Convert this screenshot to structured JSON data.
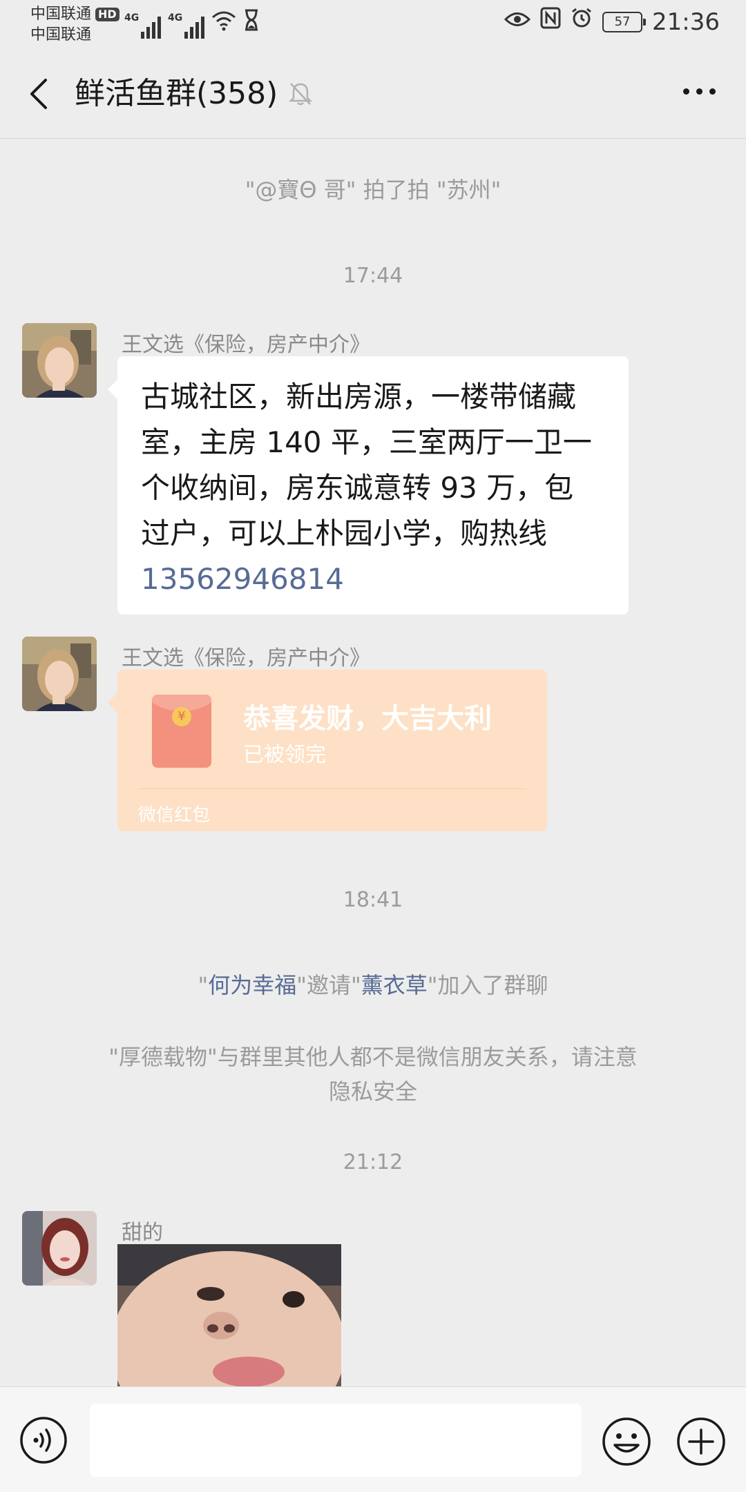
{
  "status_bar": {
    "carrier1": "中国联通",
    "carrier2": "中国联通",
    "hd_badge": "HD",
    "network1": "4G",
    "network2": "4G",
    "battery": "57",
    "time": "21:36"
  },
  "navbar": {
    "title": "鲜活鱼群(358)"
  },
  "messages": {
    "pat_notice": "\"@寶Θ 哥\" 拍了拍 \"苏州\"",
    "time1": "17:44",
    "msg1": {
      "sender": "王文选《保险，房产中介》",
      "lines": [
        "古城社区，新出房源，一楼带储藏",
        "室，主房 140 平，三室两厅一卫一",
        "个收纳间，房东诚意转 93 万，包",
        "过户，可以上朴园小学，购热线"
      ],
      "phone": "13562946814"
    },
    "msg2": {
      "sender": "王文选《保险，房产中介》",
      "red_packet_title": "恭喜发财，大吉大利",
      "red_packet_status": "已被领完",
      "red_packet_footer": "微信红包"
    },
    "time2": "18:41",
    "invite": {
      "q1": "\"",
      "inviter": "何为幸福",
      "middle": "\"邀请\"",
      "invitee": "薰衣草",
      "tail": "\"加入了群聊"
    },
    "privacy_line1": "\"厚德载物\"与群里其他人都不是微信朋友关系，请注意",
    "privacy_line2": "隐私安全",
    "time3": "21:12",
    "msg3": {
      "sender": "甜的"
    }
  },
  "input_bar": {
    "placeholder": ""
  },
  "colors": {
    "background": "#ededed",
    "link": "#576b95",
    "red_packet": "#fde0c5"
  }
}
